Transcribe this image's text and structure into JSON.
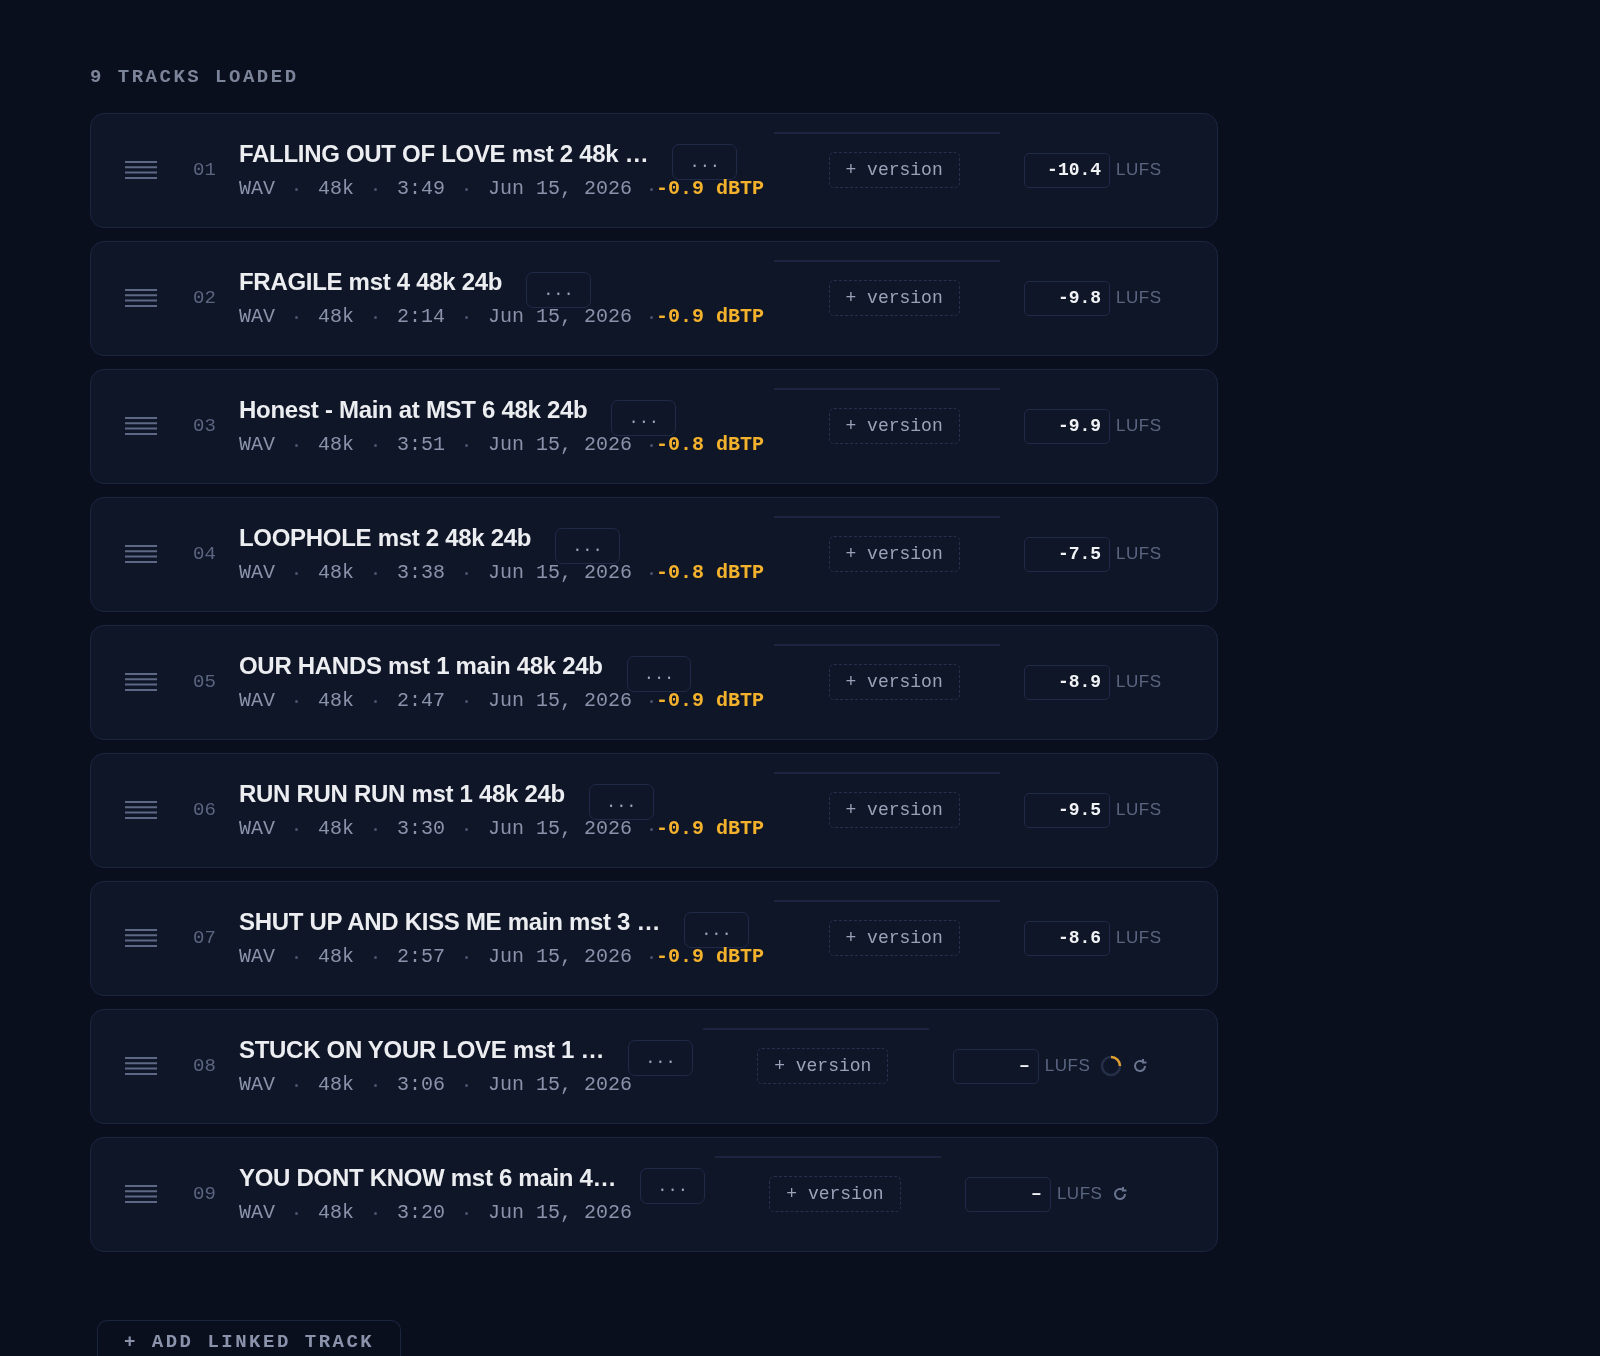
{
  "header": "9 TRACKS LOADED",
  "tracks": [
    {
      "number": "01",
      "title": "FALLING OUT OF LOVE mst 2 48k …",
      "format": "WAV",
      "rate": "48k",
      "duration": "3:49",
      "date": "Jun 15, 2026",
      "peak": "-0.9 dBTP",
      "menu": "...",
      "version": "+ version",
      "lufs": "-10.4",
      "lufs_unit": "LUFS",
      "analyzing": false,
      "retry": false
    },
    {
      "number": "02",
      "title": "FRAGILE mst 4 48k 24b",
      "format": "WAV",
      "rate": "48k",
      "duration": "2:14",
      "date": "Jun 15, 2026",
      "peak": "-0.9 dBTP",
      "menu": "...",
      "version": "+ version",
      "lufs": "-9.8",
      "lufs_unit": "LUFS",
      "analyzing": false,
      "retry": false
    },
    {
      "number": "03",
      "title": "Honest - Main at MST 6 48k 24b",
      "format": "WAV",
      "rate": "48k",
      "duration": "3:51",
      "date": "Jun 15, 2026",
      "peak": "-0.8 dBTP",
      "menu": "...",
      "version": "+ version",
      "lufs": "-9.9",
      "lufs_unit": "LUFS",
      "analyzing": false,
      "retry": false
    },
    {
      "number": "04",
      "title": "LOOPHOLE mst 2 48k 24b",
      "format": "WAV",
      "rate": "48k",
      "duration": "3:38",
      "date": "Jun 15, 2026",
      "peak": "-0.8 dBTP",
      "menu": "...",
      "version": "+ version",
      "lufs": "-7.5",
      "lufs_unit": "LUFS",
      "analyzing": false,
      "retry": false
    },
    {
      "number": "05",
      "title": "OUR HANDS mst 1 main 48k 24b",
      "format": "WAV",
      "rate": "48k",
      "duration": "2:47",
      "date": "Jun 15, 2026",
      "peak": "-0.9 dBTP",
      "menu": "...",
      "version": "+ version",
      "lufs": "-8.9",
      "lufs_unit": "LUFS",
      "analyzing": false,
      "retry": false
    },
    {
      "number": "06",
      "title": "RUN RUN RUN mst 1 48k 24b",
      "format": "WAV",
      "rate": "48k",
      "duration": "3:30",
      "date": "Jun 15, 2026",
      "peak": "-0.9 dBTP",
      "menu": "...",
      "version": "+ version",
      "lufs": "-9.5",
      "lufs_unit": "LUFS",
      "analyzing": false,
      "retry": false
    },
    {
      "number": "07",
      "title": "SHUT UP AND KISS ME main mst 3 …",
      "format": "WAV",
      "rate": "48k",
      "duration": "2:57",
      "date": "Jun 15, 2026",
      "peak": "-0.9 dBTP",
      "menu": "...",
      "version": "+ version",
      "lufs": "-8.6",
      "lufs_unit": "LUFS",
      "analyzing": false,
      "retry": false
    },
    {
      "number": "08",
      "title": "STUCK ON YOUR LOVE mst 1 …",
      "format": "WAV",
      "rate": "48k",
      "duration": "3:06",
      "date": "Jun 15, 2026",
      "menu": "...",
      "version": "+ version",
      "lufs": "–",
      "lufs_unit": "LUFS",
      "analyzing": true,
      "retry": true
    },
    {
      "number": "09",
      "title": "YOU DONT KNOW mst 6 main 4…",
      "format": "WAV",
      "rate": "48k",
      "duration": "3:20",
      "date": "Jun 15, 2026",
      "menu": "...",
      "version": "+ version",
      "lufs": "–",
      "lufs_unit": "LUFS",
      "analyzing": false,
      "retry": true
    }
  ],
  "add_button": "+ ADD LINKED TRACK"
}
